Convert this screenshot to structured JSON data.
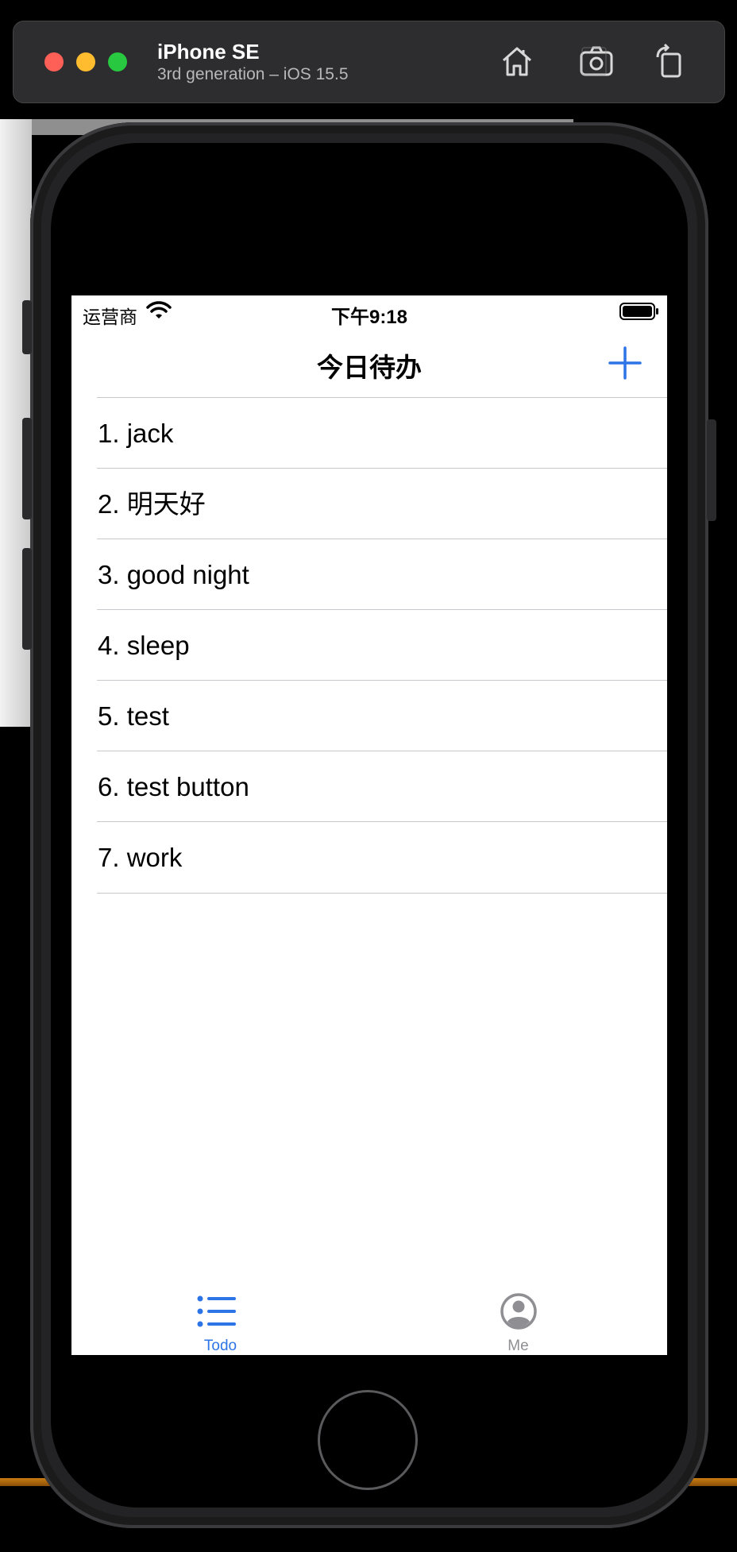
{
  "simulator": {
    "device_name": "iPhone SE",
    "device_detail": "3rd generation – iOS 15.5",
    "buttons": [
      "home-icon",
      "screenshot-icon",
      "rotate-icon"
    ]
  },
  "status_bar": {
    "carrier": "运营商",
    "time": "下午9:18"
  },
  "nav": {
    "title": "今日待办",
    "add_icon": "plus-icon"
  },
  "todos": [
    {
      "label": "1. jack"
    },
    {
      "label": "2. 明天好"
    },
    {
      "label": "3. good night"
    },
    {
      "label": "4. sleep"
    },
    {
      "label": "5. test"
    },
    {
      "label": "6. test button"
    },
    {
      "label": "7. work"
    }
  ],
  "tabs": [
    {
      "label": "Todo",
      "icon": "list-icon",
      "selected": true
    },
    {
      "label": "Me",
      "icon": "person-circle-icon",
      "selected": false
    }
  ],
  "colors": {
    "accent": "#2d74e6",
    "inactive_tab": "#8e8e93",
    "separator": "#c8c8cc"
  }
}
